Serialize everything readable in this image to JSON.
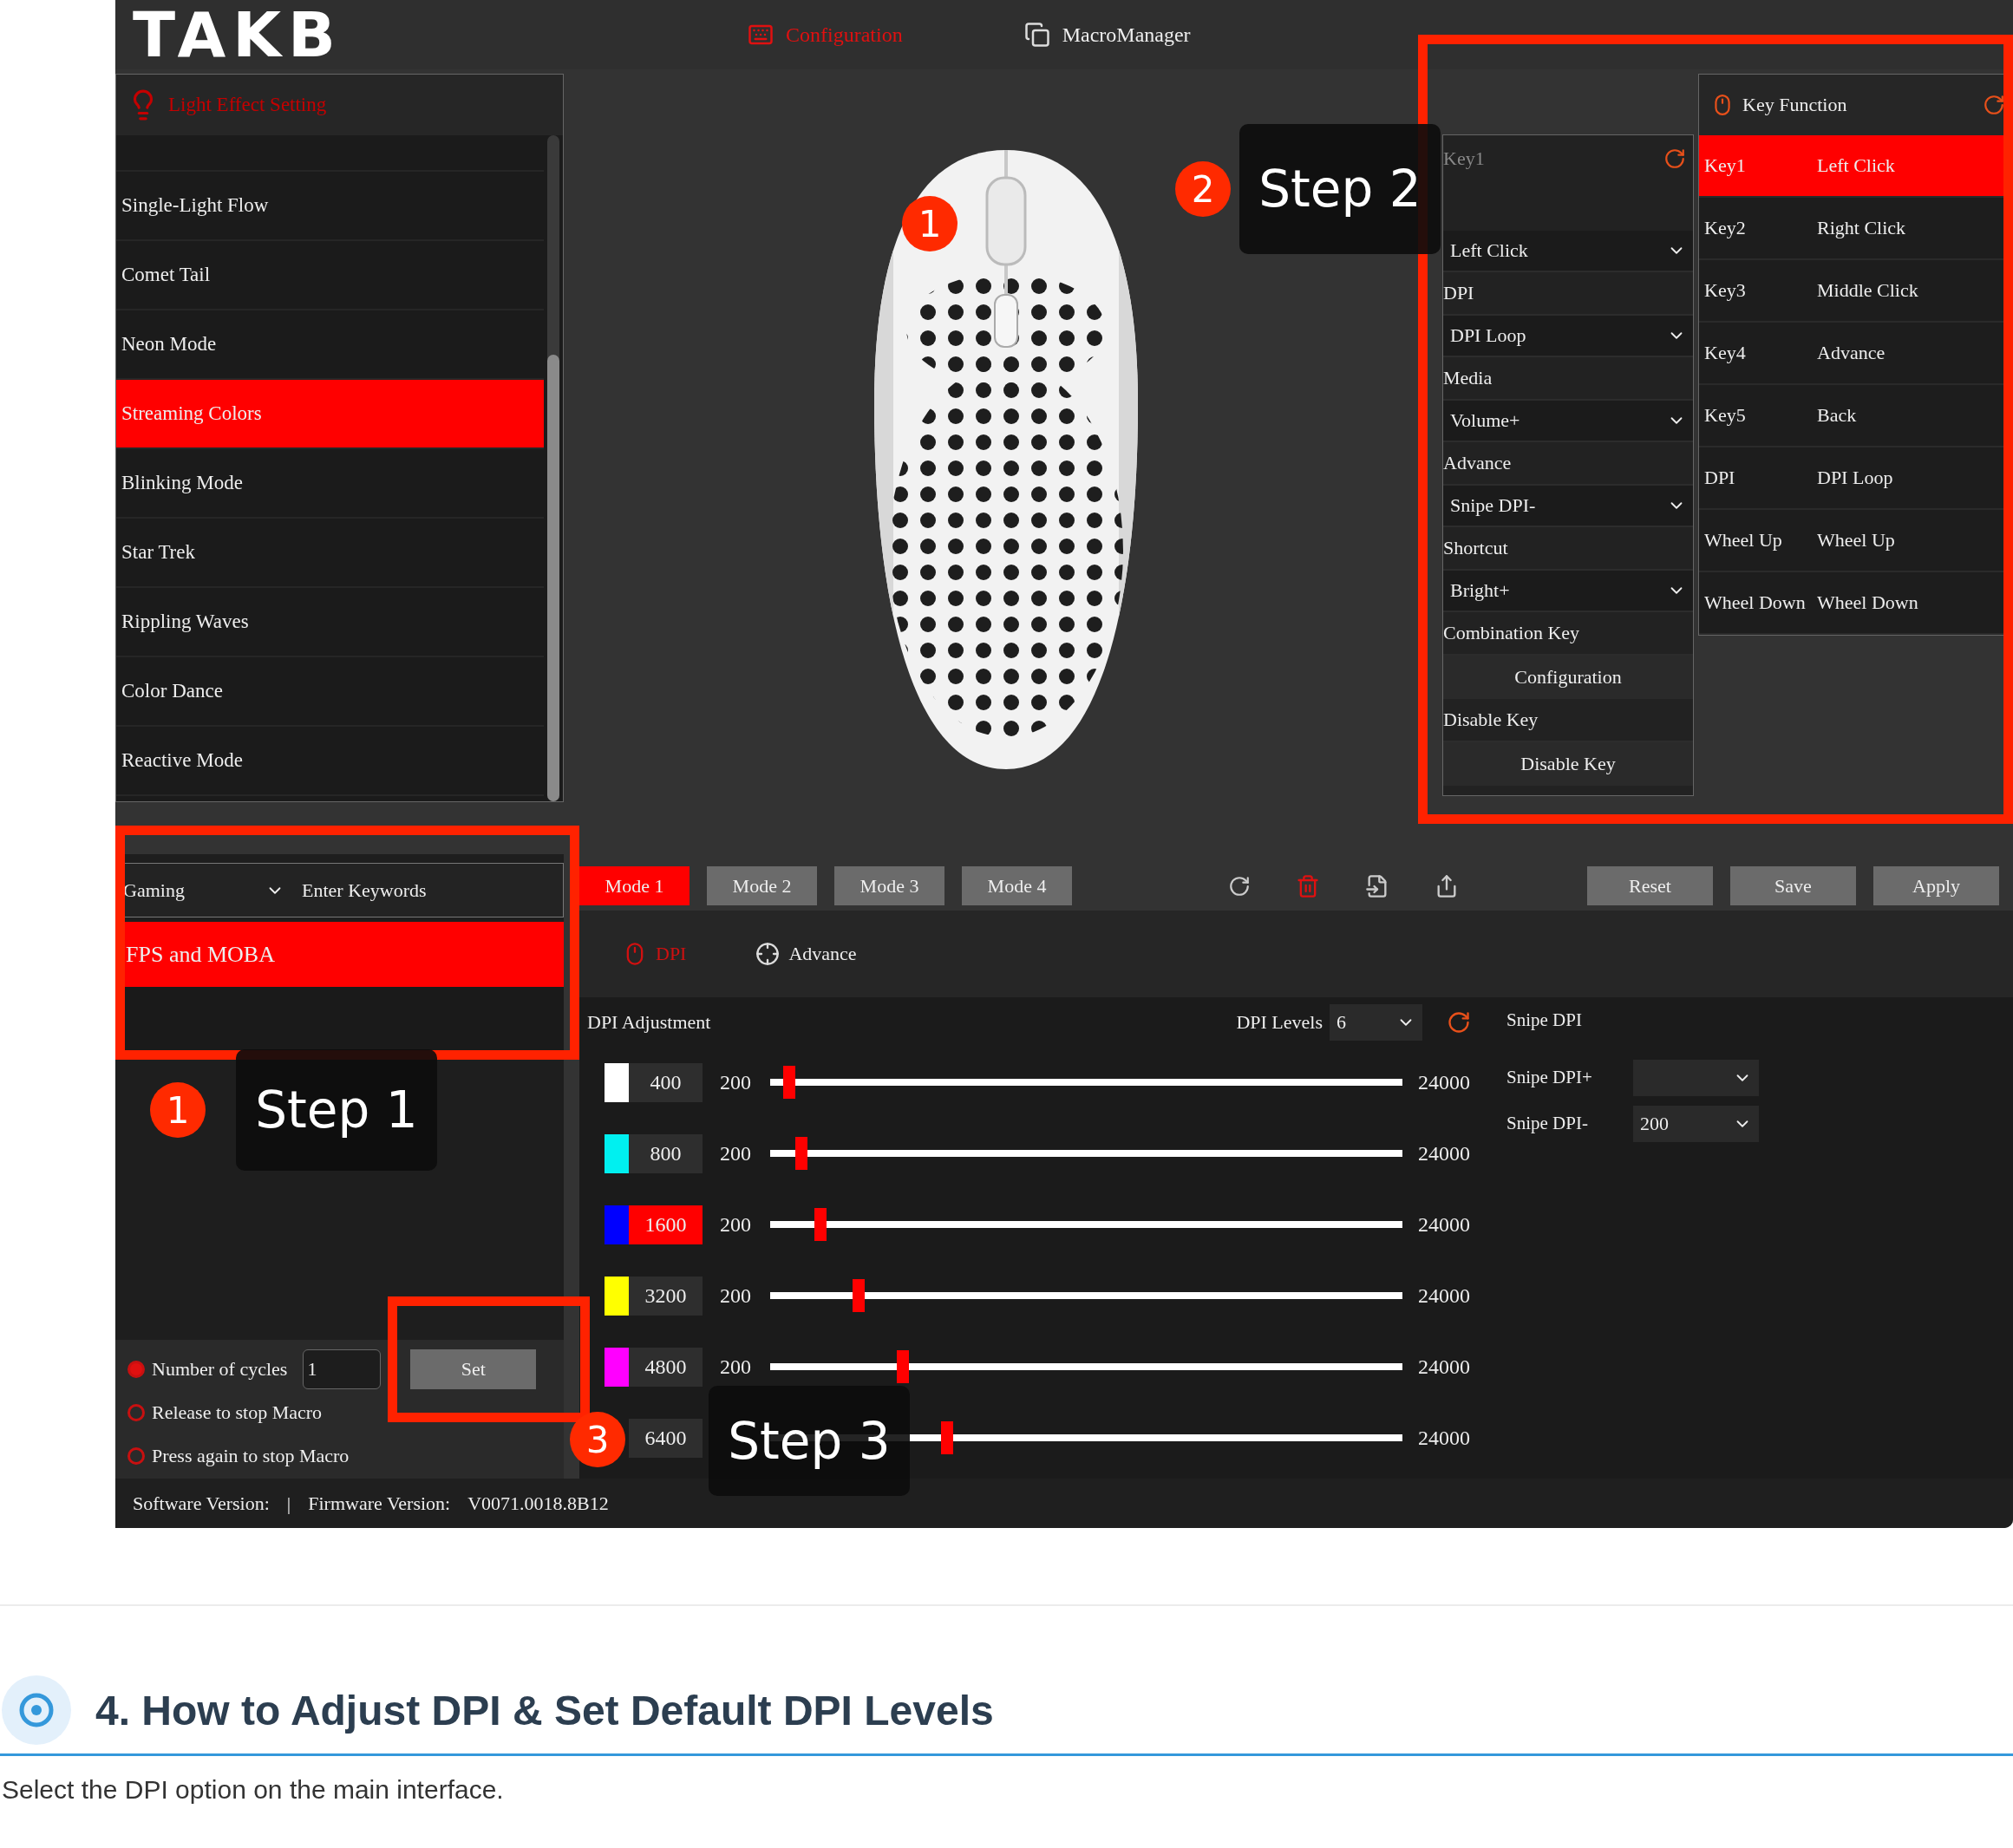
{
  "logo": {
    "text": "TAKB"
  },
  "nav": [
    {
      "label": "Configuration",
      "selected": true
    },
    {
      "label": "MacroManager",
      "selected": false
    }
  ],
  "light_effect": {
    "title": "Light Effect Setting",
    "items": [
      {
        "label": "Single-Light Flow",
        "selected": false
      },
      {
        "label": "Comet Tail",
        "selected": false
      },
      {
        "label": "Neon Mode",
        "selected": false
      },
      {
        "label": "Streaming Colors",
        "selected": true
      },
      {
        "label": "Blinking Mode",
        "selected": false
      },
      {
        "label": "Star Trek",
        "selected": false
      },
      {
        "label": "Rippling Waves",
        "selected": false
      },
      {
        "label": "Color Dance",
        "selected": false
      },
      {
        "label": "Reactive Mode",
        "selected": false
      }
    ]
  },
  "mouse_badge": "1",
  "key_config": {
    "title": "Key1",
    "rows": [
      {
        "kind": "select",
        "value": "Left Click"
      },
      {
        "kind": "heading",
        "label": "DPI"
      },
      {
        "kind": "select",
        "value": "DPI Loop"
      },
      {
        "kind": "heading",
        "label": "Media"
      },
      {
        "kind": "select",
        "value": "Volume+"
      },
      {
        "kind": "heading",
        "label": "Advance"
      },
      {
        "kind": "select",
        "value": "Snipe DPI-"
      },
      {
        "kind": "heading",
        "label": "Shortcut"
      },
      {
        "kind": "select",
        "value": "Bright+"
      },
      {
        "kind": "heading",
        "label": "Combination Key"
      },
      {
        "kind": "button",
        "label": "Configuration"
      },
      {
        "kind": "heading",
        "label": "Disable Key"
      },
      {
        "kind": "button",
        "label": "Disable Key"
      }
    ]
  },
  "key_function": {
    "title": "Key Function",
    "rows": [
      {
        "key": "Key1",
        "function": "Left Click",
        "selected": true
      },
      {
        "key": "Key2",
        "function": "Right Click",
        "selected": false
      },
      {
        "key": "Key3",
        "function": "Middle Click",
        "selected": false
      },
      {
        "key": "Key4",
        "function": "Advance",
        "selected": false
      },
      {
        "key": "Key5",
        "function": "Back",
        "selected": false
      },
      {
        "key": "DPI",
        "function": "DPI Loop",
        "selected": false
      },
      {
        "key": "Wheel Up",
        "function": "Wheel Up",
        "selected": false
      },
      {
        "key": "Wheel Down",
        "function": "Wheel Down",
        "selected": false
      }
    ]
  },
  "preset": {
    "category": "Gaming",
    "search_placeholder": "Enter Keywords",
    "items": [
      {
        "label": "FPS and MOBA",
        "selected": true
      }
    ]
  },
  "macro": {
    "options": [
      {
        "label": "Number of cycles",
        "selected": true
      },
      {
        "label": "Release to stop Macro",
        "selected": false
      },
      {
        "label": "Press again to stop Macro",
        "selected": false
      }
    ],
    "cycles": "1",
    "set_button": "Set"
  },
  "modes": [
    {
      "label": "Mode 1",
      "selected": true
    },
    {
      "label": "Mode 2",
      "selected": false
    },
    {
      "label": "Mode 3",
      "selected": false
    },
    {
      "label": "Mode 4",
      "selected": false
    }
  ],
  "actions": [
    "Reset",
    "Save",
    "Apply"
  ],
  "sub_tabs": [
    {
      "label": "DPI",
      "selected": true
    },
    {
      "label": "Advance",
      "selected": false
    }
  ],
  "dpi": {
    "title": "DPI Adjustment",
    "levels_label": "DPI Levels",
    "levels_value": "6",
    "rows": [
      {
        "color": "#ffffff",
        "value": "400",
        "min": "200",
        "max": "24000",
        "level": 0.02,
        "selected": false
      },
      {
        "color": "#00f0f0",
        "value": "800",
        "min": "200",
        "max": "24000",
        "level": 0.04,
        "selected": false
      },
      {
        "color": "#0000ff",
        "value": "1600",
        "min": "200",
        "max": "24000",
        "level": 0.07,
        "selected": true
      },
      {
        "color": "#ffff00",
        "value": "3200",
        "min": "200",
        "max": "24000",
        "level": 0.13,
        "selected": false
      },
      {
        "color": "#ff00ff",
        "value": "4800",
        "min": "200",
        "max": "24000",
        "level": 0.2,
        "selected": false
      },
      {
        "value": "6400",
        "max": "24000",
        "level": 0.27,
        "selected": false
      }
    ]
  },
  "snipe": {
    "title": "Snipe DPI",
    "fields": [
      {
        "label": "Snipe DPI+"
      },
      {
        "label": "Snipe DPI-",
        "value": "200"
      }
    ]
  },
  "status_bar": {
    "software": "Software Version:",
    "separator": "|",
    "firmware": "Firmware Version:",
    "firmware_value": "V0071.0018.8B12"
  },
  "callouts": [
    {
      "number": "1",
      "text": "Step 1"
    },
    {
      "number": "2",
      "text": "Step 2"
    },
    {
      "number": "3",
      "text": "Step 3"
    }
  ],
  "article": {
    "heading": "4. How to Adjust DPI & Set Default DPI Levels",
    "paragraph": "Select the DPI option on the main interface."
  }
}
